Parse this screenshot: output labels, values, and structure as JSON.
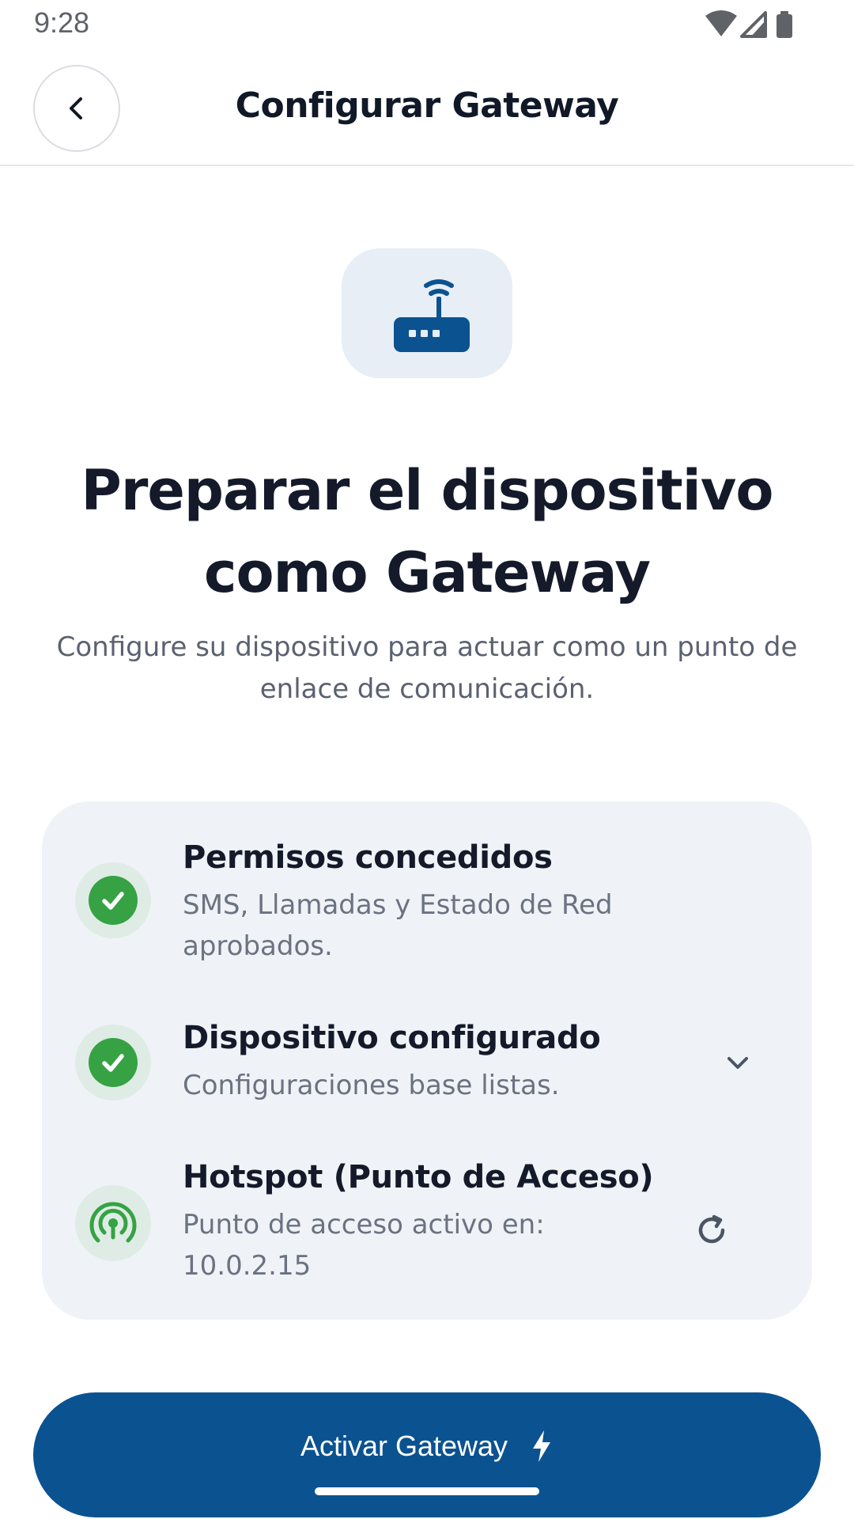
{
  "status_bar": {
    "time": "9:28",
    "icons": [
      "wifi-icon",
      "signal-icon",
      "battery-icon"
    ]
  },
  "app_bar": {
    "back_icon": "chevron-left-icon",
    "title": "Configurar Gateway"
  },
  "hero": {
    "icon": "router-wifi-icon",
    "headline": "Preparar el dispositivo como Gateway",
    "subtitle": "Configure su dispositivo para actuar como un punto de enlace de comunicación."
  },
  "steps": [
    {
      "title": "Permisos concedidos",
      "description": "SMS, Llamadas y Estado de Red aprobados.",
      "status": "completed",
      "status_icon": "check-circle-icon"
    },
    {
      "title": "Dispositivo configurado",
      "description": "Configuraciones base listas.",
      "status": "completed",
      "status_icon": "check-circle-icon",
      "action_icon": "chevron-down-icon"
    },
    {
      "title": "Hotspot (Punto de Acceso)",
      "description": "Punto de acceso activo en: 10.0.2.15",
      "status": "active",
      "status_icon": "hotspot-icon",
      "action_icon": "refresh-icon"
    }
  ],
  "primary_action": {
    "label": "Activar Gateway",
    "icon": "lightning-bolt-icon"
  },
  "colors": {
    "primary": "#0b5291",
    "success": "#36a244",
    "card_bg": "#eff3f7",
    "hero_bg": "#e7eef5",
    "text_dark": "#141a2a",
    "text_muted": "#6b7280"
  }
}
